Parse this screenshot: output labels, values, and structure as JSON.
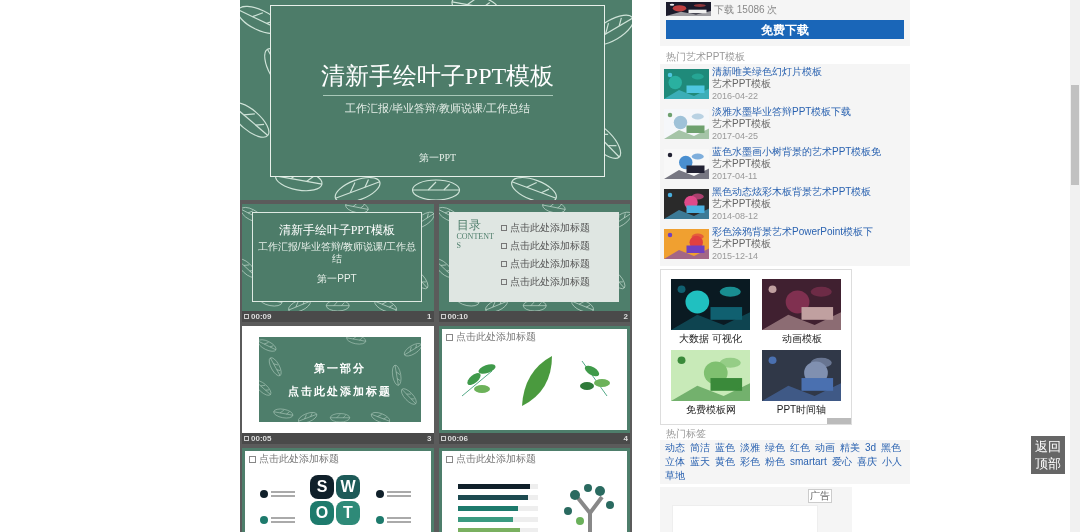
{
  "main_slide": {
    "title": "清新手绘叶子PPT模板",
    "subtitle": "工作汇报/毕业答辩/教师说课/工作总结",
    "footer": "第一PPT"
  },
  "thumbnails": [
    {
      "kind": "cover",
      "time": "00:09",
      "number": "1",
      "title": "清新手绘叶子PPT模板",
      "subtitle": "工作汇报/毕业答辩/教师说课/工作总结",
      "footer": "第一PPT"
    },
    {
      "kind": "contents",
      "time": "00:10",
      "number": "2",
      "heading": "目录",
      "heading_en": "CONTENTS",
      "items": [
        "点击此处添加标题",
        "点击此处添加标题",
        "点击此处添加标题",
        "点击此处添加标题"
      ]
    },
    {
      "kind": "section",
      "time": "00:05",
      "number": "3",
      "lines": [
        "第一部分",
        "点击此处添加标题"
      ]
    },
    {
      "kind": "leaves",
      "time": "00:06",
      "number": "4",
      "heading": "点击此处添加标题"
    },
    {
      "kind": "swot",
      "heading": "点击此处添加标题",
      "letters": [
        "S",
        "W",
        "O",
        "T"
      ]
    },
    {
      "kind": "bars",
      "heading": "点击此处添加标题"
    }
  ],
  "sidebar": {
    "download_count": "下载 15086 次",
    "download_button": "免费下载",
    "hot_templates": {
      "title": "热门艺术PPT模板",
      "items": [
        {
          "title": "清新唯美绿色幻灯片模板",
          "category": "艺术PPT模板",
          "date": "2016-04-22"
        },
        {
          "title": "淡雅水墨毕业答辩PPT模板下载",
          "category": "艺术PPT模板",
          "date": "2017-04-25"
        },
        {
          "title": "蓝色水墨画小树背景的艺术PPT模板免",
          "category": "艺术PPT模板",
          "date": "2017-04-11"
        },
        {
          "title": "黑色动态炫彩木板背景艺术PPT模板",
          "category": "艺术PPT模板",
          "date": "2014-08-12"
        },
        {
          "title": "彩色涂鸦背景艺术PowerPoint模板下",
          "category": "艺术PPT模板",
          "date": "2015-12-14"
        }
      ]
    },
    "ad_grid": [
      {
        "caption": "大数据 可视化"
      },
      {
        "caption": "动画模板"
      },
      {
        "caption": "免费模板网"
      },
      {
        "caption": "PPT时间轴"
      }
    ],
    "hot_tags": {
      "title": "热门标签",
      "items": [
        "动态",
        "简洁",
        "蓝色",
        "淡雅",
        "绿色",
        "红色",
        "动画",
        "精美",
        "3d",
        "黑色",
        "立体",
        "蓝天",
        "黄色",
        "彩色",
        "粉色",
        "smartart",
        "爱心",
        "喜庆",
        "小人",
        "草地"
      ]
    },
    "ad_label": "广告"
  },
  "back_to_top": "返回顶部"
}
